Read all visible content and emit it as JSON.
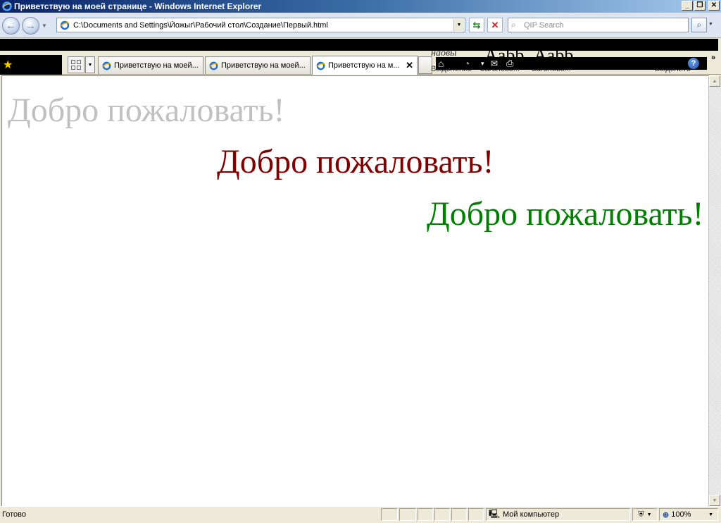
{
  "window": {
    "title": "Приветствую на моей странице - Windows Internet Explorer",
    "minimize": "_",
    "maximize": "❐",
    "close": "✕"
  },
  "address_bar": {
    "url": "C:\\Documents and Settings\\Йожыг\\Рабочий стол\\Создание\\Первый.html"
  },
  "search": {
    "placeholder": "QIP Search"
  },
  "tabs": [
    {
      "label": "Приветствую на моей...",
      "active": false
    },
    {
      "label": "Приветствую на моей...",
      "active": false
    },
    {
      "label": "Приветствую на м...",
      "active": true
    }
  ],
  "overlap_fragments": {
    "f1": "наовы",
    "f2": "Aabb",
    "f3": "Aabb",
    "f4": "Выделение",
    "f5": "Заголово...",
    "f6": "Заголово...",
    "f7": "Выделить"
  },
  "page": {
    "headings": [
      {
        "text": "Добро пожаловать!",
        "color": "#c0c0c0"
      },
      {
        "text": "Добро пожаловать!",
        "color": "#800000"
      },
      {
        "text": "Добро пожаловать!",
        "color": "#008000"
      }
    ]
  },
  "status_bar": {
    "status": "Готово",
    "zone": "Мой компьютер",
    "zoom": "100%"
  }
}
